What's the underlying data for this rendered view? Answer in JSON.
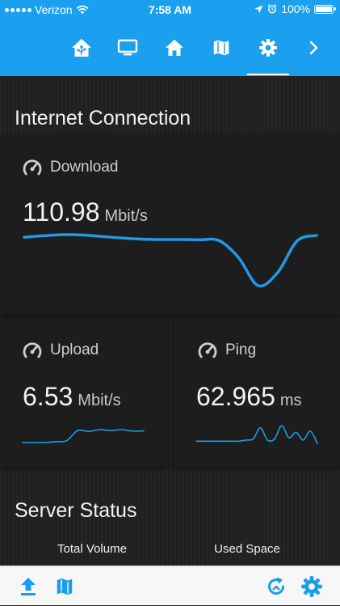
{
  "status_bar": {
    "carrier": "Verizon",
    "time": "7:58 AM",
    "battery": "100%",
    "battery_level": 1.0
  },
  "top_nav": {
    "tabs": [
      {
        "icon": "home-assistant-icon",
        "active": false
      },
      {
        "icon": "tv-icon",
        "active": false
      },
      {
        "icon": "home-icon",
        "active": false
      },
      {
        "icon": "map-icon",
        "active": false
      },
      {
        "icon": "gear-icon",
        "active": true
      },
      {
        "icon": "chevron-right-icon",
        "active": false
      }
    ],
    "accent_color": "#1aa0ee"
  },
  "internet": {
    "title": "Internet Connection",
    "download": {
      "label": "Download",
      "value": "110.98",
      "unit": "Mbit/s",
      "history": [
        110.5,
        110.9,
        111.2,
        111.1,
        110.7,
        110.3,
        110.0,
        109.9,
        109.9,
        109.8,
        109.6,
        105.0,
        97.5,
        101.0,
        109.5,
        110.98
      ]
    },
    "upload": {
      "label": "Upload",
      "value": "6.53",
      "unit": "Mbit/s",
      "history": [
        5.9,
        5.9,
        5.9,
        5.95,
        6.0,
        6.55,
        6.5,
        6.6,
        6.55,
        6.6,
        6.52,
        6.53
      ]
    },
    "ping": {
      "label": "Ping",
      "value": "62.965",
      "unit": "ms",
      "history": [
        40,
        40,
        40,
        40,
        40,
        40,
        40,
        41,
        42,
        52,
        41,
        42,
        54,
        43,
        48,
        41,
        49,
        38
      ]
    },
    "line_color": "#1e9be6"
  },
  "server_status": {
    "title": "Server Status",
    "columns": [
      "Total Volume",
      "Used Space"
    ]
  },
  "bottom_bar": {
    "left_icons": [
      "upload-icon",
      "map-icon"
    ],
    "right_icons": [
      "refresh-icon",
      "gear-icon"
    ]
  }
}
